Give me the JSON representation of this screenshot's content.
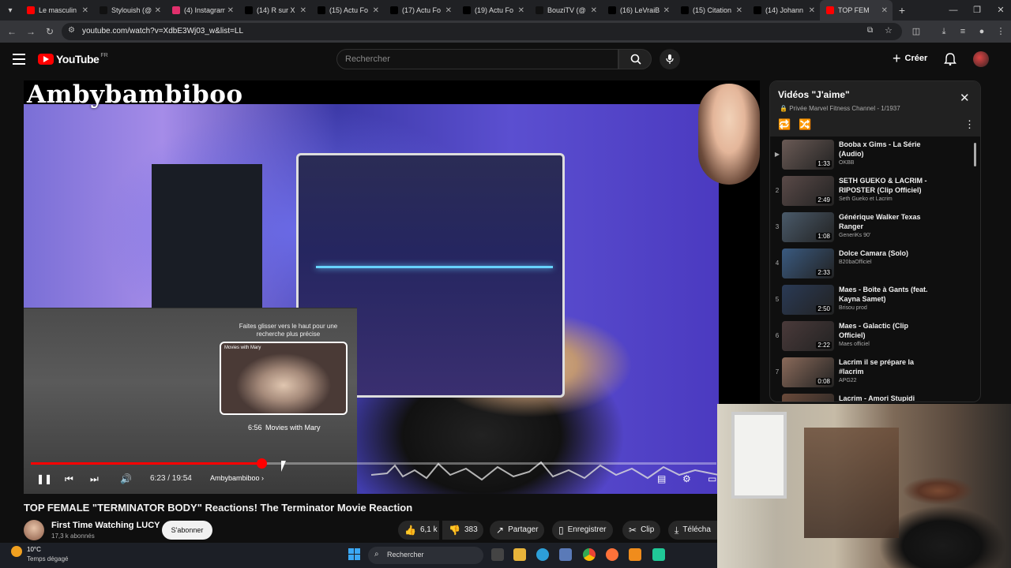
{
  "browser": {
    "tabs": [
      {
        "label": "Le masculin",
        "icon": "youtube-icon",
        "color": "#ff0000"
      },
      {
        "label": "Stylouish (@",
        "icon": "tiktok-icon",
        "color": "#111111"
      },
      {
        "label": "(4) Instagram",
        "icon": "instagram-icon",
        "color": "#e1306c"
      },
      {
        "label": "(14) R sur X",
        "icon": "x-icon",
        "color": "#000000"
      },
      {
        "label": "(15) Actu Fo",
        "icon": "x-icon",
        "color": "#000000"
      },
      {
        "label": "(17) Actu Fo",
        "icon": "x-icon",
        "color": "#000000"
      },
      {
        "label": "(19) Actu Fo",
        "icon": "x-icon",
        "color": "#000000"
      },
      {
        "label": "BouziTV (@",
        "icon": "tiktok-icon",
        "color": "#111111"
      },
      {
        "label": "(16) LeVraiB",
        "icon": "x-icon",
        "color": "#000000"
      },
      {
        "label": "(15) Citation",
        "icon": "x-icon",
        "color": "#000000"
      },
      {
        "label": "(14) Johann",
        "icon": "x-icon",
        "color": "#000000"
      },
      {
        "label": "TOP FEM",
        "icon": "youtube-icon",
        "color": "#ff0000",
        "active": true
      }
    ],
    "url": "youtube.com/watch?v=XdbE3Wj03_w&list=LL"
  },
  "youtube": {
    "logo_word": "YouTube",
    "logo_country": "FR",
    "search_placeholder": "Rechercher",
    "create_label": "Créer"
  },
  "player": {
    "overlay_title": "Ambybambiboo",
    "mini_hint": "Faites glisser vers le haut pour une recherche plus précise",
    "mini_thumb_text": "Movies with Mary",
    "mini_time": "6:56",
    "mini_channel": "Movies with Mary",
    "time": "6:23 / 19:54",
    "chapter": "Ambybambiboo",
    "progress_fraction": 0.336
  },
  "video": {
    "title": "TOP FEMALE \"TERMINATOR BODY\" Reactions! The Terminator Movie Reaction",
    "channel": "First Time Watching LUCY",
    "subscribers": "17,3 k abonnés",
    "subscribe_label": "S'abonner",
    "likes": "6,1 k",
    "dislikes": "383",
    "share_label": "Partager",
    "save_label": "Enregistrer",
    "clip_label": "Clip",
    "download_label": "Télécha"
  },
  "playlist": {
    "title": "Vidéos \"J'aime\"",
    "subtitle": "Privée Marvel Fitness Channel - 1/1937",
    "items": [
      {
        "index": "▶",
        "title": "Booba x Gims - La Série (Audio)",
        "channel": "OKBB",
        "duration": "1:33",
        "thumb": "#6a5a55"
      },
      {
        "index": "2",
        "title": "SETH GUEKO & LACRIM - RIPOSTER (Clip Officiel)",
        "channel": "Seth Gueko et Lacrim",
        "duration": "2:49",
        "thumb": "#5a4a48"
      },
      {
        "index": "3",
        "title": "Générique Walker Texas Ranger",
        "channel": "GeneriKs 90'",
        "duration": "1:08",
        "thumb": "#4a5a6a"
      },
      {
        "index": "4",
        "title": "Dolce Camara (Solo)",
        "channel": "B20baOfficiel",
        "duration": "2:33",
        "thumb": "#3a5a80"
      },
      {
        "index": "5",
        "title": "Maes - Boîte à Gants (feat. Kayna Samet)",
        "channel": "Brisou prod",
        "duration": "2:50",
        "thumb": "#2a3a55"
      },
      {
        "index": "6",
        "title": "Maes - Galactic (Clip Officiel)",
        "channel": "Maes officiel",
        "duration": "2:22",
        "thumb": "#4a3a3a"
      },
      {
        "index": "7",
        "title": "Lacrim il se prépare la #lacrim",
        "channel": "APG22",
        "duration": "0:08",
        "thumb": "#8a6a5a"
      },
      {
        "index": "8",
        "title": "Lacrim - Amori Stupidi",
        "channel": "",
        "duration": "",
        "thumb": "#6a4a3a"
      }
    ]
  },
  "taskbar": {
    "temp": "10°C",
    "weather": "Temps dégagé",
    "search": "Rechercher"
  }
}
